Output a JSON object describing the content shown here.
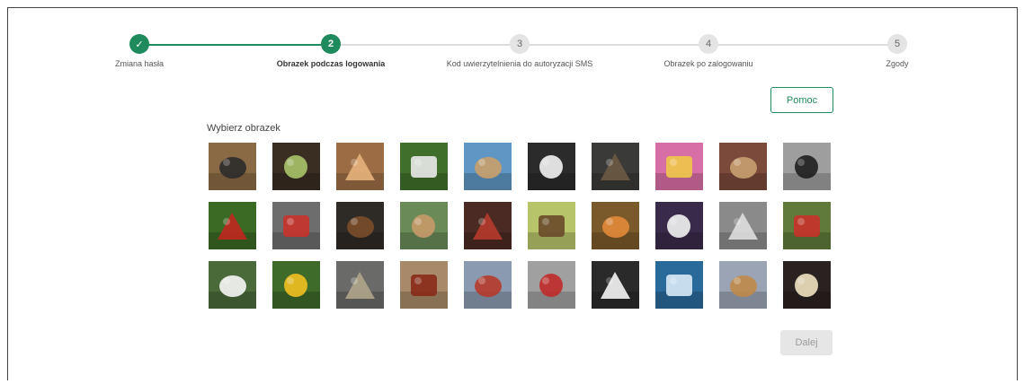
{
  "stepper": {
    "steps": [
      {
        "number": "✓",
        "label": "Zmiana hasła",
        "state": "done"
      },
      {
        "number": "2",
        "label": "Obrazek podczas logowania",
        "state": "active"
      },
      {
        "number": "3",
        "label": "Kod uwierzytelnienia do autoryzacji SMS",
        "state": "todo"
      },
      {
        "number": "4",
        "label": "Obrazek po zalogowaniu",
        "state": "todo"
      },
      {
        "number": "5",
        "label": "Zgody",
        "state": "todo"
      }
    ]
  },
  "help_button": "Pomoc",
  "grid_title": "Wybierz obrazek",
  "next_button": "Dalej",
  "accent_color": "#1f8a5c",
  "images": [
    {
      "icon": "kettlebell-icon",
      "bg": "#8a6a44",
      "fg": "#2b2b2b"
    },
    {
      "icon": "salad-plate-icon",
      "bg": "#3a2d22",
      "fg": "#a8c46a"
    },
    {
      "icon": "tiger-icon",
      "bg": "#9c6d45",
      "fg": "#e5b17b"
    },
    {
      "icon": "badminton-icon",
      "bg": "#3f6f2a",
      "fg": "#e9e9e9"
    },
    {
      "icon": "boat-beach-icon",
      "bg": "#5f96c3",
      "fg": "#c9a06a"
    },
    {
      "icon": "swan-icon",
      "bg": "#2b2b2b",
      "fg": "#f2f2f2"
    },
    {
      "icon": "eagle-icon",
      "bg": "#3a3a38",
      "fg": "#6b5a44"
    },
    {
      "icon": "billiard-balls-icon",
      "bg": "#d86ea6",
      "fg": "#f0c84a"
    },
    {
      "icon": "books-icon",
      "bg": "#7b4a3a",
      "fg": "#c8a070"
    },
    {
      "icon": "bicycle-icon",
      "bg": "#9e9e9e",
      "fg": "#1e1e1e"
    },
    {
      "icon": "ladybug-icon",
      "bg": "#3b6a25",
      "fg": "#c0281f"
    },
    {
      "icon": "motorcycle-icon",
      "bg": "#6d6d6d",
      "fg": "#c8322a"
    },
    {
      "icon": "shoe-icon",
      "bg": "#2e2a26",
      "fg": "#7a4c2a"
    },
    {
      "icon": "dog-icon",
      "bg": "#6a8a58",
      "fg": "#c89a6a"
    },
    {
      "icon": "dartboard-icon",
      "bg": "#4a2a22",
      "fg": "#b53a2c"
    },
    {
      "icon": "butterfly-icon",
      "bg": "#b7c46a",
      "fg": "#6a4a2a"
    },
    {
      "icon": "melon-icon",
      "bg": "#7a5a2a",
      "fg": "#e38a3a"
    },
    {
      "icon": "bowling-pins-icon",
      "bg": "#3a2a4a",
      "fg": "#f2f2f2"
    },
    {
      "icon": "rings-icon",
      "bg": "#8a8a8a",
      "fg": "#dedede"
    },
    {
      "icon": "apple-icon",
      "bg": "#5f7a3a",
      "fg": "#c8322a"
    },
    {
      "icon": "daisy-icon",
      "bg": "#4a6a3a",
      "fg": "#f6f6f6"
    },
    {
      "icon": "sunflower-icon",
      "bg": "#3e6a2a",
      "fg": "#f0c020"
    },
    {
      "icon": "cat-icon",
      "bg": "#6a6a68",
      "fg": "#b0a58a"
    },
    {
      "icon": "rooster-icon",
      "bg": "#a88a6a",
      "fg": "#8a2a1a"
    },
    {
      "icon": "bench-icon",
      "bg": "#8a9ab0",
      "fg": "#b53a2c"
    },
    {
      "icon": "chair-icon",
      "bg": "#a0a0a0",
      "fg": "#c02a2a"
    },
    {
      "icon": "stork-icon",
      "bg": "#2a2a2a",
      "fg": "#f4f4f4"
    },
    {
      "icon": "surfer-icon",
      "bg": "#2a6a9a",
      "fg": "#d8eaf6"
    },
    {
      "icon": "spice-bowls-icon",
      "bg": "#9aa4b4",
      "fg": "#c08a4a"
    },
    {
      "icon": "cheesecake-icon",
      "bg": "#2a2220",
      "fg": "#f0e2c0"
    }
  ]
}
